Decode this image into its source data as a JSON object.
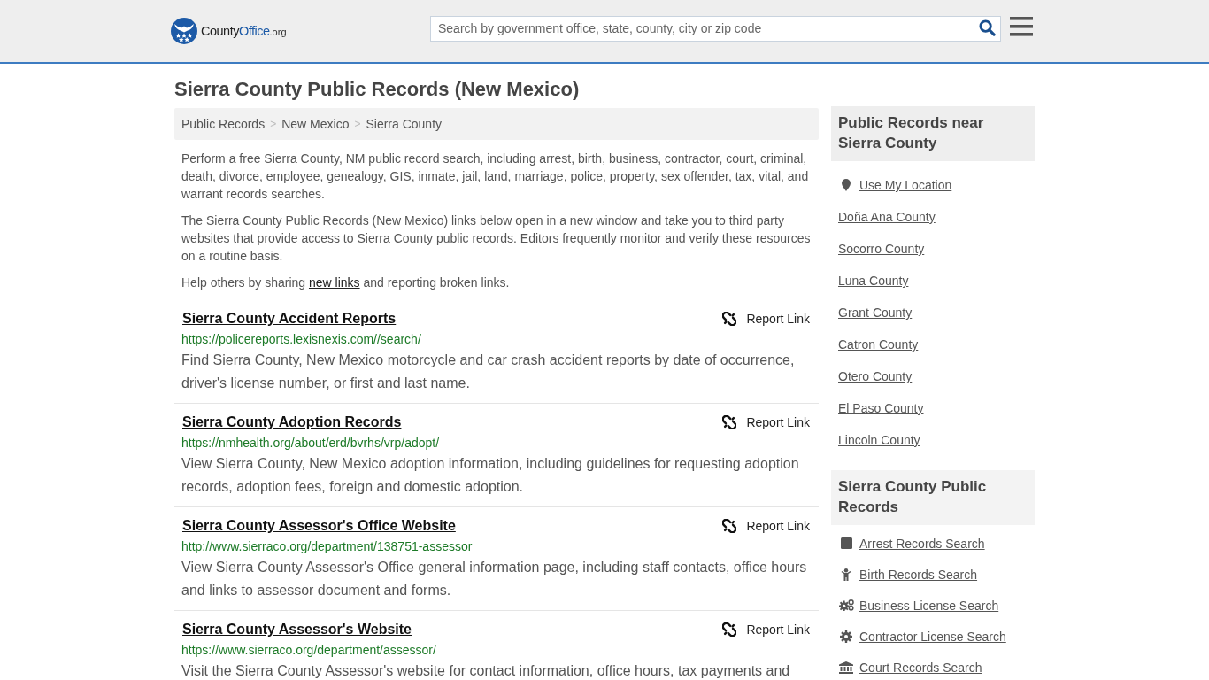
{
  "header": {
    "logo": {
      "name": "County",
      "accent": "Office",
      "suffix": ".org"
    },
    "search": {
      "placeholder": "Search by government office, state, county, city or zip code"
    }
  },
  "page_title": "Sierra County Public Records (New Mexico)",
  "breadcrumb": {
    "separator": ">",
    "items": [
      "Public Records",
      "New Mexico",
      "Sierra County"
    ]
  },
  "intro": [
    {
      "text": "Perform a free Sierra County, NM public record search, including arrest, birth, business, contractor, court, criminal, death, divorce, employee, genealogy, GIS, inmate, jail, land, marriage, police, property, sex offender, tax, vital, and warrant records searches."
    },
    {
      "text": "The Sierra County Public Records (New Mexico) links below open in a new window and take you to third party websites that provide access to Sierra County public records. Editors frequently monitor and verify these resources on a routine basis."
    },
    {
      "text": "Help others by sharing",
      "link": "new links",
      "after": "and reporting broken links."
    }
  ],
  "records": [
    {
      "title": "Sierra County Accident Reports",
      "url": "https://policereports.lexisnexis.com//search/",
      "description": "Find Sierra County, New Mexico motorcycle and car crash accident reports by date of occurrence, driver's license number, or first and last name.",
      "report": "Report Link"
    },
    {
      "title": "Sierra County Adoption Records",
      "url": "https://nmhealth.org/about/erd/bvrhs/vrp/adopt/",
      "description": "View Sierra County, New Mexico adoption information, including guidelines for requesting adoption records, adoption fees, foreign and domestic adoption.",
      "report": "Report Link"
    },
    {
      "title": "Sierra County Assessor's Office Website",
      "url": "http://www.sierraco.org/department/138751-assessor",
      "description": "View Sierra County Assessor's Office general information page, including staff contacts, office hours and links to assessor document and forms.",
      "report": "Report Link"
    },
    {
      "title": "Sierra County Assessor's Website",
      "url": "https://www.sierraco.org/department/assessor/",
      "description": "Visit the Sierra County Assessor's website for contact information, office hours, tax payments and",
      "report": "Report Link"
    }
  ],
  "sidebar": [
    {
      "heading": "Public Records near Sierra County",
      "items": [
        {
          "label": "Use My Location",
          "kind": "location"
        },
        {
          "label": "Doña Ana County",
          "kind": "plain"
        },
        {
          "label": "Socorro County",
          "kind": "plain"
        },
        {
          "label": "Luna County",
          "kind": "plain"
        },
        {
          "label": "Grant County",
          "kind": "plain"
        },
        {
          "label": "Catron County",
          "kind": "plain"
        },
        {
          "label": "Otero County",
          "kind": "plain"
        },
        {
          "label": "El Paso County",
          "kind": "plain"
        },
        {
          "label": "Lincoln County",
          "kind": "plain"
        }
      ]
    },
    {
      "heading": "Sierra County Public Records",
      "items": [
        {
          "label": "Arrest Records Search",
          "kind": "arrest"
        },
        {
          "label": "Birth Records Search",
          "kind": "birth"
        },
        {
          "label": "Business License Search",
          "kind": "business"
        },
        {
          "label": "Contractor License Search",
          "kind": "contractor"
        },
        {
          "label": "Court Records Search",
          "kind": "court"
        }
      ]
    }
  ]
}
